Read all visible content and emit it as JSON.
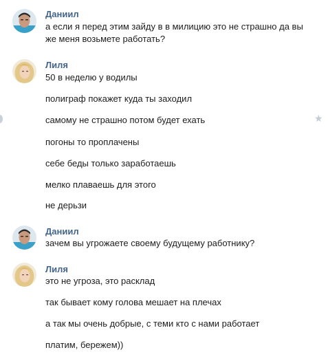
{
  "messages": [
    {
      "author": "Даниил",
      "lines": [
        "а если я перед этим зайду в в милицию это не страшно да вы",
        "же меня возьмете работать?"
      ]
    },
    {
      "author": "Лиля",
      "lines": [
        "50 в неделю у водилы",
        "полиграф покажет куда ты заходил",
        "самому не страшно потом будет ехать",
        "погоны то проплачены",
        "себе беды только заработаешь",
        "мелко плаваешь для этого",
        "не дерьзи"
      ]
    },
    {
      "author": "Даниил",
      "lines": [
        "зачем вы угрожаете своему будущему работнику?"
      ]
    },
    {
      "author": "Лиля",
      "lines": [
        "это не угроза, это расклад",
        "так бывает кому голова мешает на плечах",
        "а так мы очень добрые, с теми кто с нами работает",
        "платим, бережем))"
      ]
    }
  ],
  "icons": {
    "star": "star-icon",
    "avatar_daniil": "avatar-man",
    "avatar_lilya": "avatar-woman"
  },
  "colors": {
    "author": "#42648b",
    "text": "#1c1c1c",
    "star": "#c3cbd4"
  }
}
